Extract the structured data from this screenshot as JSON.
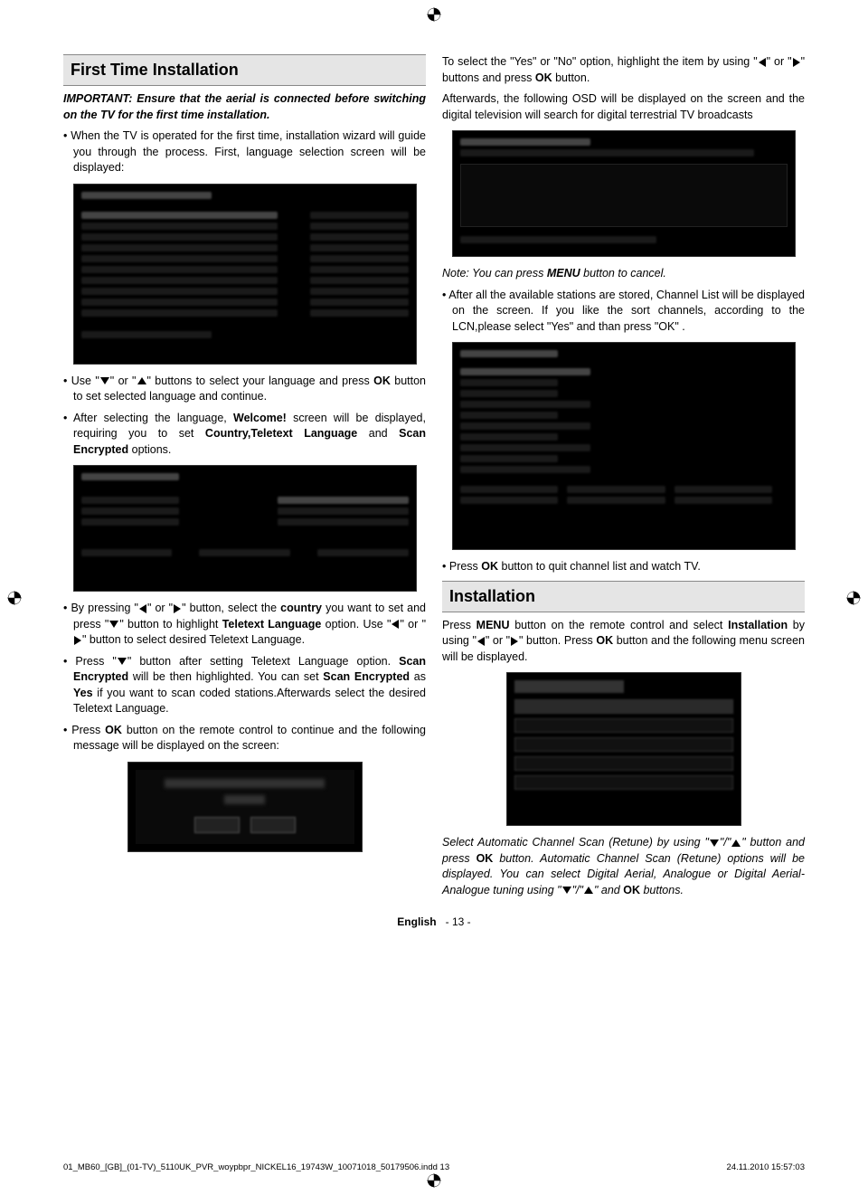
{
  "heading1": "First Time Installation",
  "left": {
    "important": "IMPORTANT: Ensure that the aerial is connected before switching on the TV for the first time installation.",
    "b1": "When the TV is operated for the first time, installation wizard will guide you through the process. First, language selection screen will be displayed:",
    "b2a": "Use \"",
    "b2b": "\" or \"",
    "b2c": "\" buttons to select your language and press ",
    "b2d": " button to set selected language and continue.",
    "ok1": "OK",
    "b3a": "After selecting the language, ",
    "b3b": "Welcome!",
    "b3c": " screen will be displayed, requiring you to set ",
    "b3d": "Country,Teletext Language",
    "b3e": " and ",
    "b3f": "Scan Encrypted",
    "b3g": " options.",
    "b4a": "By pressing \"",
    "b4b": "\" or \"",
    "b4c": "\" button, select the ",
    "b4d": "country",
    "b4e": " you want to set and press \"",
    "b4f": "\" button to highlight ",
    "b4g": "Teletext Language",
    "b4h": " option. Use \"",
    "b4i": "\" or \"",
    "b4j": "\" button to select desired Teletext Language.",
    "b5a": "Press \"",
    "b5b": "\" button after setting Teletext Language option. ",
    "b5c": "Scan Encrypted",
    "b5d": " will be then highlighted. You can set ",
    "b5e": "Scan Encrypted",
    "b5f": " as ",
    "b5g": "Yes",
    "b5h": " if you want to scan coded stations.Afterwards select the desired Teletext Language.",
    "b6a": "Press ",
    "b6b": "OK",
    "b6c": " button on the remote control to continue and the following message will be displayed on the screen:"
  },
  "right": {
    "p1a": "To select the \"Yes\" or \"No\" option, highlight the item by using \"",
    "p1b": "\" or \"",
    "p1c": "\" buttons and press ",
    "p1d": "OK",
    "p1e": " button.",
    "p2": "Afterwards, the following OSD will be displayed on the screen and the digital television will search for digital terrestrial TV broadcasts",
    "note_a": "Note: You can press ",
    "note_b": "MENU",
    "note_c": " button to cancel.",
    "b1": "After all the available stations are stored, Channel List will be displayed on the screen. If you like the sort channels, according to the LCN,please select \"Yes\" and than press \"OK\" .",
    "b2a": "Press ",
    "b2b": "OK",
    "b2c": " button to quit channel list and watch TV.",
    "heading2": "Installation",
    "p3a": "Press ",
    "p3b": "MENU",
    "p3c": " button on the remote control and select ",
    "p3d": "Installation",
    "p3e": " by using \"",
    "p3f": "\" or \"",
    "p3g": "\" button. Press ",
    "p3h": "OK",
    "p3i": " button and the following menu screen will be displayed.",
    "p4a": "Select Automatic Channel Scan (Retune) by using \"",
    "p4b": "\"/\"",
    "p4c": "\" button and press ",
    "p4d": "OK",
    "p4e": " button. Automatic Channel Scan (Retune) options will be displayed. You can select Digital Aerial,  Analogue or Digital Aerial-Analogue tuning using \"",
    "p4f": "\"/\"",
    "p4g": "\" and ",
    "p4h": "OK",
    "p4i": " buttons."
  },
  "page_label": "English",
  "page_num": "- 13 -",
  "footer_left": "01_MB60_[GB]_(01-TV)_5110UK_PVR_woypbpr_NICKEL16_19743W_10071018_50179506.indd   13",
  "footer_right": "24.11.2010   15:57:03"
}
